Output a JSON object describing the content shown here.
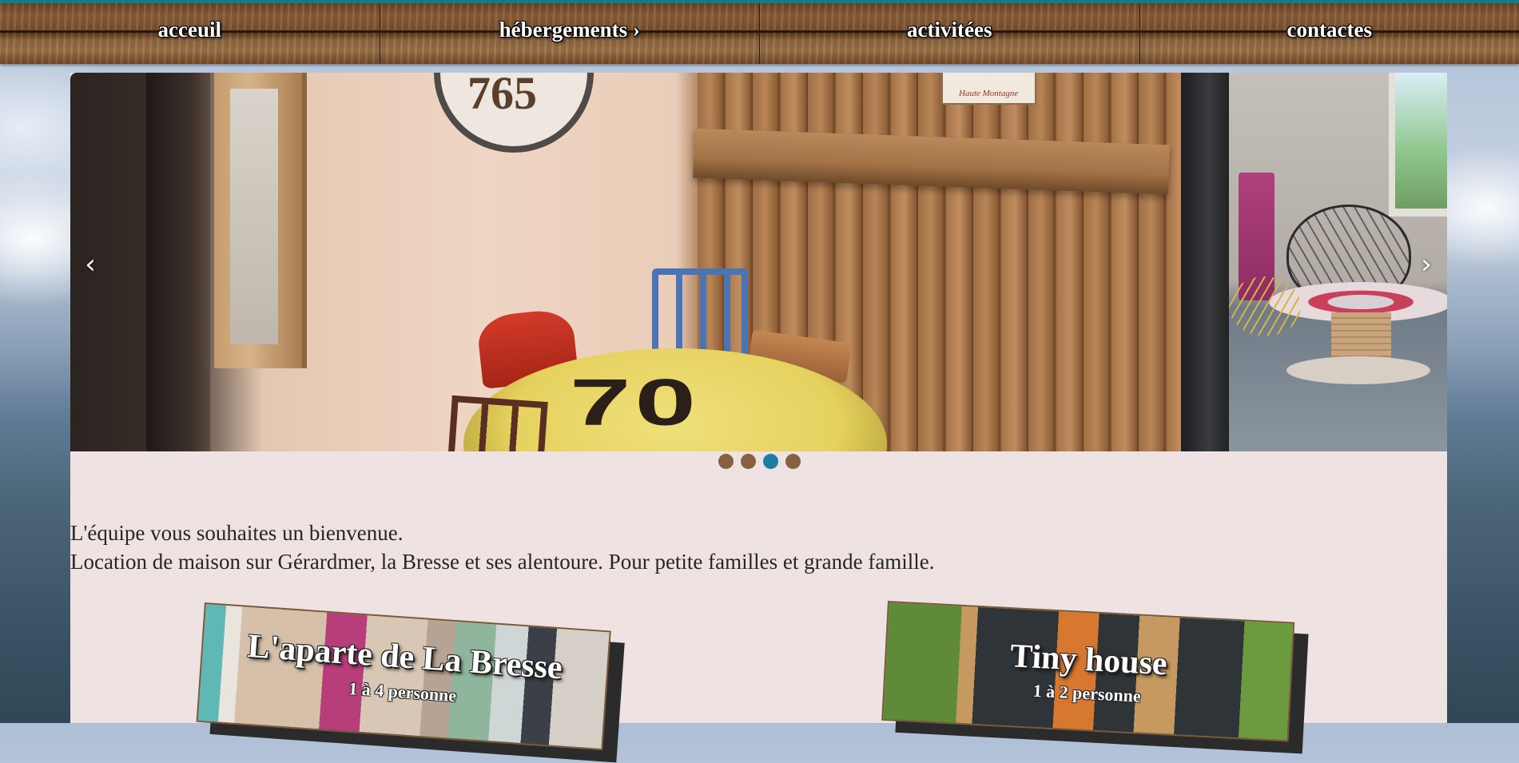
{
  "nav": {
    "items": [
      {
        "label": "acceuil"
      },
      {
        "label": "hébergements ›"
      },
      {
        "label": "activitées"
      },
      {
        "label": "contactes"
      }
    ]
  },
  "carousel": {
    "image_text_clock": "765",
    "image_text_table": "70",
    "image_text_sign": "Haute Montagne",
    "prev_icon": "‹",
    "next_icon": "›",
    "slide_count": 4,
    "active_slide": 3
  },
  "welcome": {
    "line1": "L'équipe vous souhaites un bienvenue.",
    "line2": "Location de maison sur Gérardmer, la Bresse et ses alentoure. Pour petite familles et grande famille."
  },
  "cards": [
    {
      "title": "L'aparte de La Bresse",
      "subtitle": "1 à 4 personne"
    },
    {
      "title": "Tiny house",
      "subtitle": "1 à 2 personne"
    }
  ],
  "colors": {
    "nav_top_border": "#0f7c86",
    "main_bg": "#efe2e2",
    "dot": "#87603f",
    "dot_active": "#1b7fa3"
  }
}
